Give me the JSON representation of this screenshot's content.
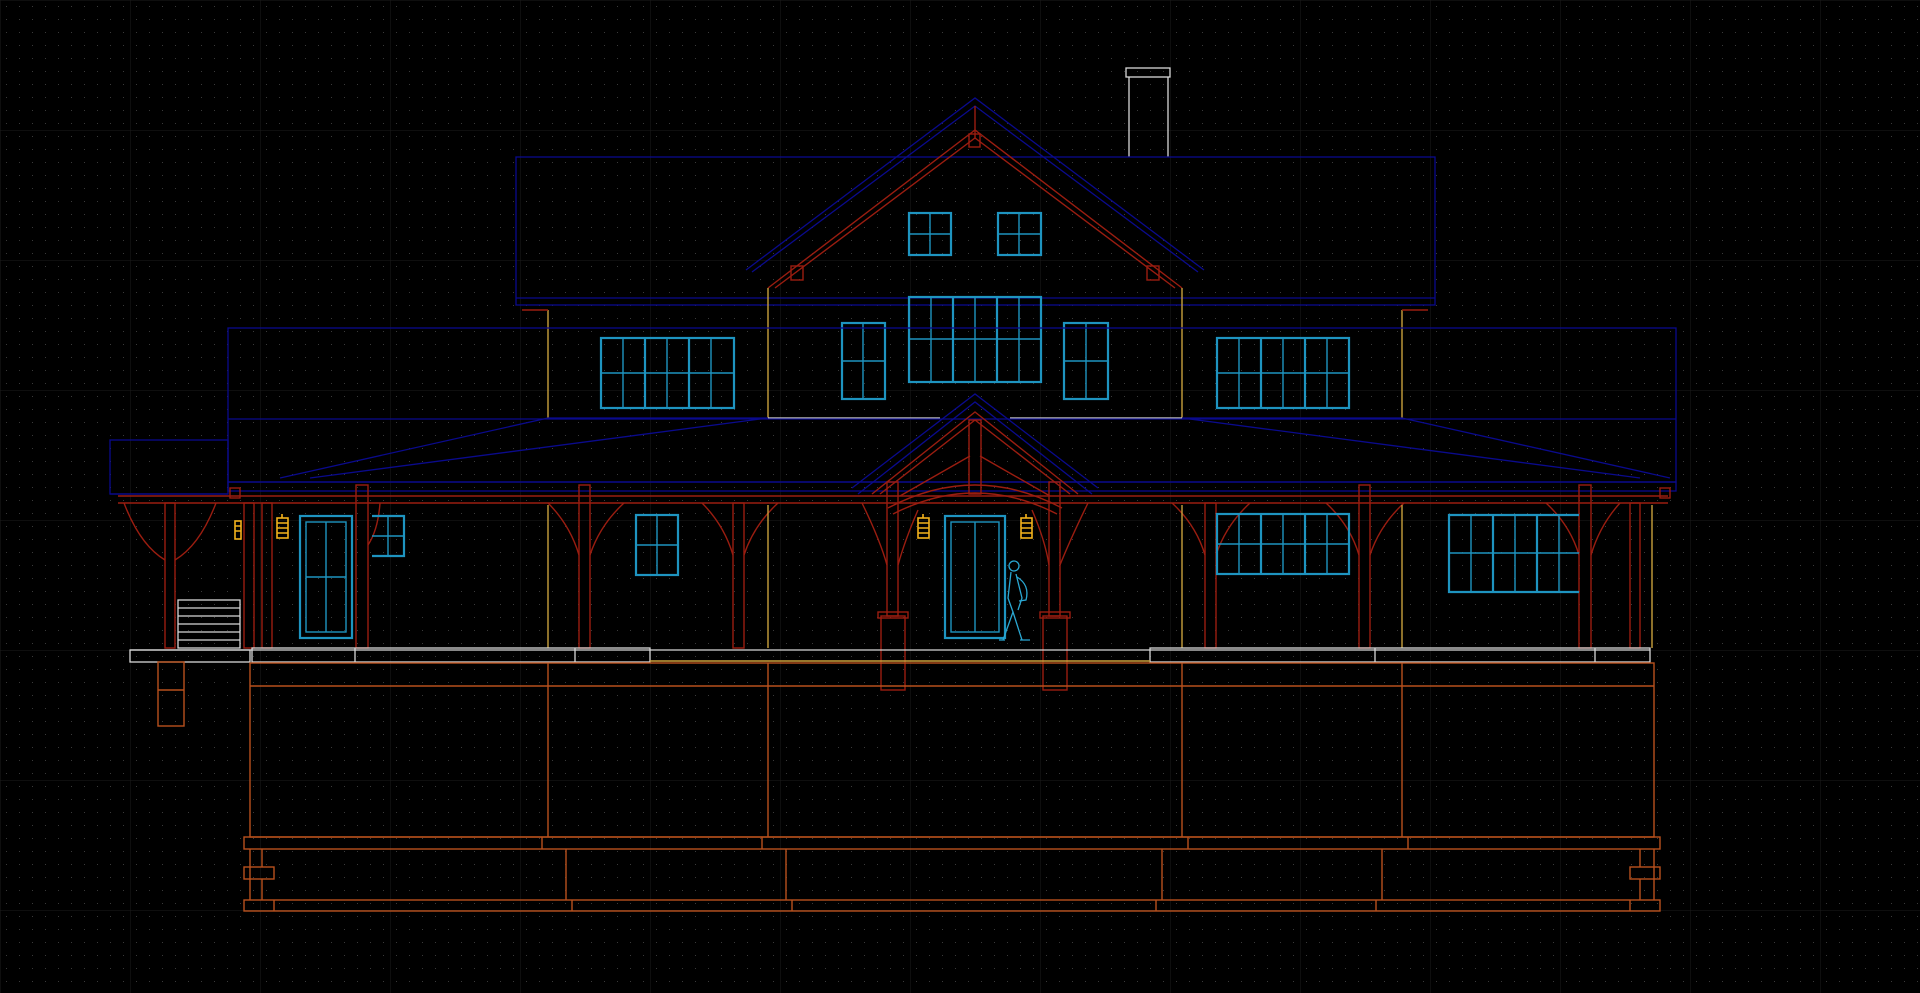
{
  "drawing": {
    "view": "front-elevation",
    "colors": {
      "background": "#000000",
      "grid_dot": "#3a3a3a",
      "grid_line": "#1c1c1c",
      "roof": "#0a0a8c",
      "timber": "#9a1d10",
      "foundation": "#b8501c",
      "trim": "#c9a03c",
      "window": "#1e94c0",
      "lamp": "#f2b21c",
      "chimney": "#d8d8d8",
      "figure": "#2aa7d2"
    },
    "icons": [
      "wall-lantern-icon",
      "person-figure-icon"
    ]
  }
}
